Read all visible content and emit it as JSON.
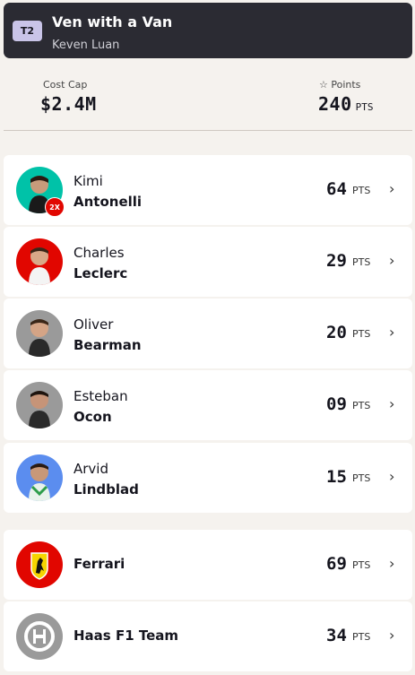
{
  "team": {
    "badge": "T2",
    "name": "Ven with a Van",
    "owner": "Keven Luan"
  },
  "stats": {
    "cost_cap_label": "Cost Cap",
    "cost_cap_value": "$2.4M",
    "points_label": "Points",
    "points_icon": "star-outline-icon",
    "points_value": "240",
    "points_unit": "PTS"
  },
  "drivers": [
    {
      "first": "Kimi",
      "last": "Antonelli",
      "points": "64",
      "unit": "PTS",
      "multiplier": "2X",
      "avatar_color": "#00c2a8"
    },
    {
      "first": "Charles",
      "last": "Leclerc",
      "points": "29",
      "unit": "PTS",
      "avatar_color": "#e10600"
    },
    {
      "first": "Oliver",
      "last": "Bearman",
      "points": "20",
      "unit": "PTS",
      "avatar_color": "#9a9a9a"
    },
    {
      "first": "Esteban",
      "last": "Ocon",
      "points": "09",
      "unit": "PTS",
      "avatar_color": "#9a9a9a"
    },
    {
      "first": "Arvid",
      "last": "Lindblad",
      "points": "15",
      "unit": "PTS",
      "avatar_color": "#5b8def"
    }
  ],
  "constructors": [
    {
      "name": "Ferrari",
      "points": "69",
      "unit": "PTS",
      "logo_color": "#e10600"
    },
    {
      "name": "Haas F1 Team",
      "points": "34",
      "unit": "PTS",
      "logo_color": "#9a9a9a"
    }
  ]
}
